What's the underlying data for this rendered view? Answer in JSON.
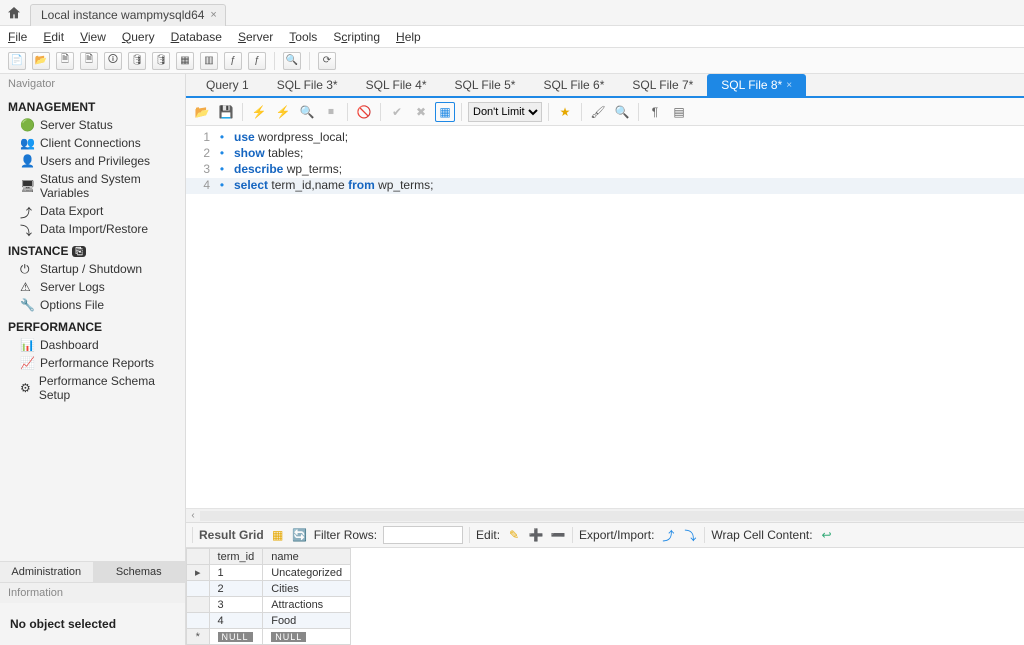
{
  "connection_tab": "Local instance wampmysqld64",
  "menus": [
    "File",
    "Edit",
    "View",
    "Query",
    "Database",
    "Server",
    "Tools",
    "Scripting",
    "Help"
  ],
  "navigator_label": "Navigator",
  "management_header": "MANAGEMENT",
  "management_items": [
    "Server Status",
    "Client Connections",
    "Users and Privileges",
    "Status and System Variables",
    "Data Export",
    "Data Import/Restore"
  ],
  "instance_header": "INSTANCE",
  "instance_items": [
    "Startup / Shutdown",
    "Server Logs",
    "Options File"
  ],
  "performance_header": "PERFORMANCE",
  "performance_items": [
    "Dashboard",
    "Performance Reports",
    "Performance Schema Setup"
  ],
  "nav_tabs": {
    "admin": "Administration",
    "schemas": "Schemas"
  },
  "info_label": "Information",
  "info_body": "No object selected",
  "sql_tabs": [
    "Query 1",
    "SQL File 3*",
    "SQL File 4*",
    "SQL File 5*",
    "SQL File 6*",
    "SQL File 7*",
    "SQL File 8*"
  ],
  "active_sql_tab": 6,
  "limit_select": "Don't Limit",
  "code_lines": [
    {
      "n": "1",
      "kw": "use",
      "rest": " wordpress_local;"
    },
    {
      "n": "2",
      "kw": "show",
      "rest": " tables;"
    },
    {
      "n": "3",
      "kw": "describe",
      "rest": " wp_terms;"
    },
    {
      "n": "4",
      "kw": "select",
      "rest": " term_id,name ",
      "kw2": "from",
      "rest2": " wp_terms;"
    }
  ],
  "result_labels": {
    "result_grid": "Result Grid",
    "filter_rows": "Filter Rows:",
    "edit": "Edit:",
    "export_import": "Export/Import:",
    "wrap": "Wrap Cell Content:"
  },
  "grid_columns": [
    "term_id",
    "name"
  ],
  "grid_rows": [
    {
      "term_id": "1",
      "name": "Uncategorized"
    },
    {
      "term_id": "2",
      "name": "Cities"
    },
    {
      "term_id": "3",
      "name": "Attractions"
    },
    {
      "term_id": "4",
      "name": "Food"
    }
  ],
  "null_label": "NULL"
}
